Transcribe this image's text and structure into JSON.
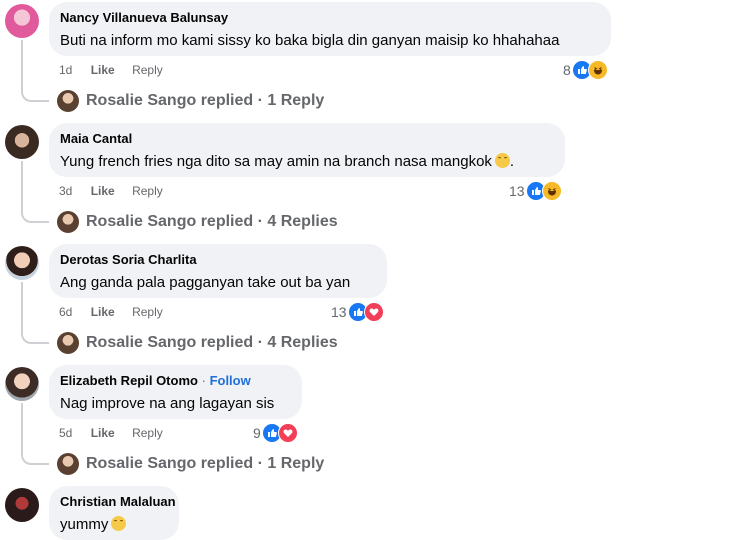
{
  "comments": [
    {
      "author": "Nancy Villanueva Balunsay",
      "text": "Buti na inform mo kami sissy ko baka bigla din ganyan maisip ko hhahahaa",
      "time": "1d",
      "like_label": "Like",
      "reply_label": "Reply",
      "reaction_count": "8",
      "reactions": [
        "like-icon",
        "haha-icon"
      ],
      "replies": "Rosalie Sango replied · 1 Reply"
    },
    {
      "author": "Maia Cantal",
      "text": "Yung french fries nga dito sa may amin na branch nasa mangkok",
      "time": "3d",
      "like_label": "Like",
      "reply_label": "Reply",
      "reaction_count": "13",
      "reactions": [
        "like-icon",
        "haha-icon"
      ],
      "replies": "Rosalie Sango replied · 4 Replies"
    },
    {
      "author": "Derotas Soria Charlita",
      "text": "Ang ganda pala pagganyan take out ba yan",
      "time": "6d",
      "like_label": "Like",
      "reply_label": "Reply",
      "reaction_count": "13",
      "reactions": [
        "like-icon",
        "love-icon"
      ],
      "replies": "Rosalie Sango replied · 4 Replies"
    },
    {
      "author": "Elizabeth Repil Otomo",
      "follow_sep": "·",
      "follow_label": "Follow",
      "text": "Nag improve na ang lagayan sis",
      "time": "5d",
      "like_label": "Like",
      "reply_label": "Reply",
      "reaction_count": "9",
      "reactions": [
        "like-icon",
        "love-icon"
      ],
      "replies": "Rosalie Sango replied · 1 Reply"
    },
    {
      "author": "Christian Malaluan",
      "text": "yummy"
    }
  ],
  "colors": {
    "like": "#1877f2",
    "haha": "#f7b928",
    "love": "#f33e58",
    "follow": "#216fdb",
    "bubble": "#f0f2f5"
  }
}
